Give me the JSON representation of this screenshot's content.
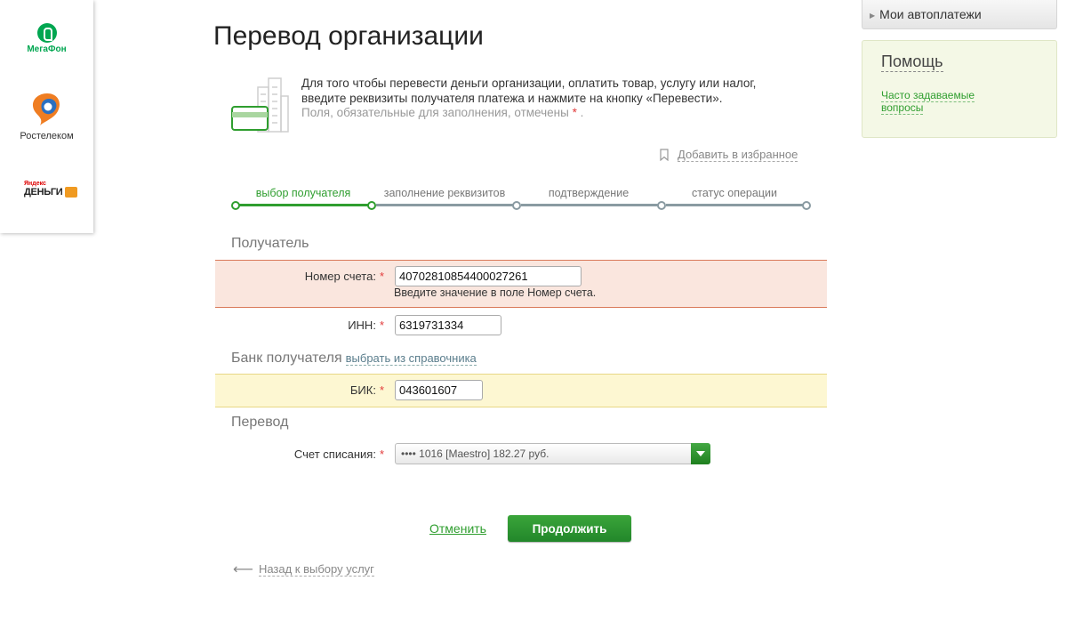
{
  "partners": {
    "megafon": "МегаФон",
    "rostelecom": "Ростелеком",
    "yandex_top": "Яндекс",
    "yandex_bottom": "ДЕНЬГИ"
  },
  "page_title": "Перевод организации",
  "intro": {
    "text": "Для того чтобы перевести деньги организации, оплатить товар, услугу или налог, введите реквизиты получателя платежа и нажмите на кнопку «Перевести».",
    "note": "Поля, обязательные для заполнения, отмечены",
    "star": "*",
    "note_end": "."
  },
  "favorite_label": "Добавить в избранное",
  "steps": [
    {
      "label": "выбор получателя",
      "active": true
    },
    {
      "label": "заполнение реквизитов",
      "active": false
    },
    {
      "label": "подтверждение",
      "active": false
    },
    {
      "label": "статус операции",
      "active": false
    }
  ],
  "sections": {
    "recipient": "Получатель",
    "bank": "Банк получателя",
    "bank_link": "выбрать из справочника",
    "transfer": "Перевод"
  },
  "fields": {
    "account": {
      "label": "Номер счета:",
      "value": "40702810854400027261",
      "error": "Введите значение в поле Номер счета."
    },
    "inn": {
      "label": "ИНН:",
      "value": "6319731334"
    },
    "bik": {
      "label": "БИК:",
      "value": "043601607"
    },
    "debit": {
      "label": "Счет списания:",
      "value": "•••• 1016 [Maestro] 182.27 руб."
    }
  },
  "required_mark": "*",
  "buttons": {
    "cancel": "Отменить",
    "continue": "Продолжить",
    "back": "Назад к выбору услуг"
  },
  "sidebar": {
    "autopay": "Мои автоплатежи",
    "help_title": "Помощь",
    "help_link": "Часто задаваемые вопросы"
  },
  "colors": {
    "accent_green": "#2f9e2f",
    "error_bg": "#fae6de",
    "warn_bg": "#fdf7d2",
    "help_bg": "#f4f8e6"
  }
}
